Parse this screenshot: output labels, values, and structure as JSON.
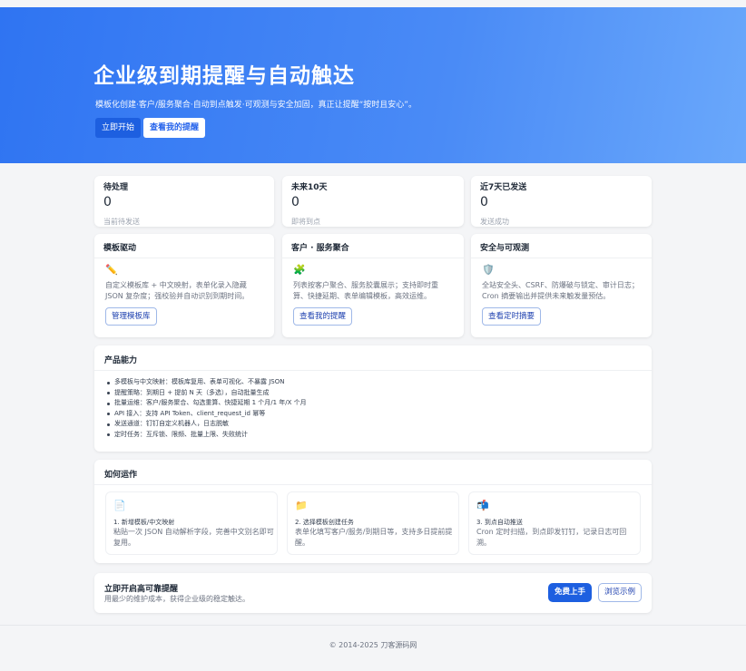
{
  "hero": {
    "title": "企业级到期提醒与自动触达",
    "subtitle": "模板化创建·客户/服务聚合·自动到点触发·可观测与安全加固，真正让提醒“按时且安心”。",
    "start_label": "立即开始",
    "view_label": "查看我的提醒",
    "bg_color": "#2f74f2"
  },
  "stats": [
    {
      "label": "待处理",
      "value": "0",
      "sub": "当前待发送"
    },
    {
      "label": "未来10天",
      "value": "0",
      "sub": "即将到点"
    },
    {
      "label": "近7天已发送",
      "value": "0",
      "sub": "发送成功"
    }
  ],
  "features": [
    {
      "title": "模板驱动",
      "icon": "pencil-icon",
      "glyph": "✏️",
      "desc": "自定义模板库 + 中文映射，表单化录入隐藏 JSON 复杂度；强校验并自动识别到期时间。",
      "button": "管理模板库"
    },
    {
      "title": "客户 · 服务聚合",
      "icon": "puzzle-icon",
      "glyph": "🧩",
      "desc": "列表按客户聚合、服务胶囊展示；支持即时重算、快捷延期、表单编辑模板，高效运维。",
      "button": "查看我的提醒"
    },
    {
      "title": "安全与可观测",
      "icon": "shield-icon",
      "glyph": "🛡️",
      "desc": "全站安全头、CSRF、防爆破与锁定、审计日志；Cron 摘要输出并提供未来触发量预估。",
      "button": "查看定时摘要"
    }
  ],
  "capabilities": {
    "title": "产品能力",
    "items": [
      "多模板与中文映射：模板库复用、表单可视化、不暴露 JSON",
      "提醒策略：到期日 + 提前 N 天（多选），自动批量生成",
      "批量运维：客户/服务聚合、勾选重算、快捷延期 1 个月/1 年/X 个月",
      "API 接入：支持 API Token、client_request_id 幂等",
      "发送通道：钉钉自定义机器人，日志脱敏",
      "定时任务：互斥锁、限频、批量上限、失败统计"
    ]
  },
  "how": {
    "title": "如何运作",
    "steps": [
      {
        "icon": "document-icon",
        "glyph": "📄",
        "title": "1. 新增模板/中文映射",
        "desc": "粘贴一次 JSON 自动解析字段，完善中文别名即可复用。"
      },
      {
        "icon": "folder-icon",
        "glyph": "📁",
        "title": "2. 选择模板创建任务",
        "desc": "表单化填写客户/服务/到期日等，支持多日提前提醒。"
      },
      {
        "icon": "mailbox-icon",
        "glyph": "📬",
        "title": "3. 到点自动推送",
        "desc": "Cron 定时扫描，到点即发钉钉，记录日志可回溯。"
      }
    ]
  },
  "cta": {
    "title": "立即开启高可靠提醒",
    "subtitle": "用最少的维护成本，获得企业级的稳定触达。",
    "free_label": "免费上手",
    "browse_label": "浏览示例"
  },
  "footer": {
    "text": "© 2014-2025 刀客源码网"
  }
}
